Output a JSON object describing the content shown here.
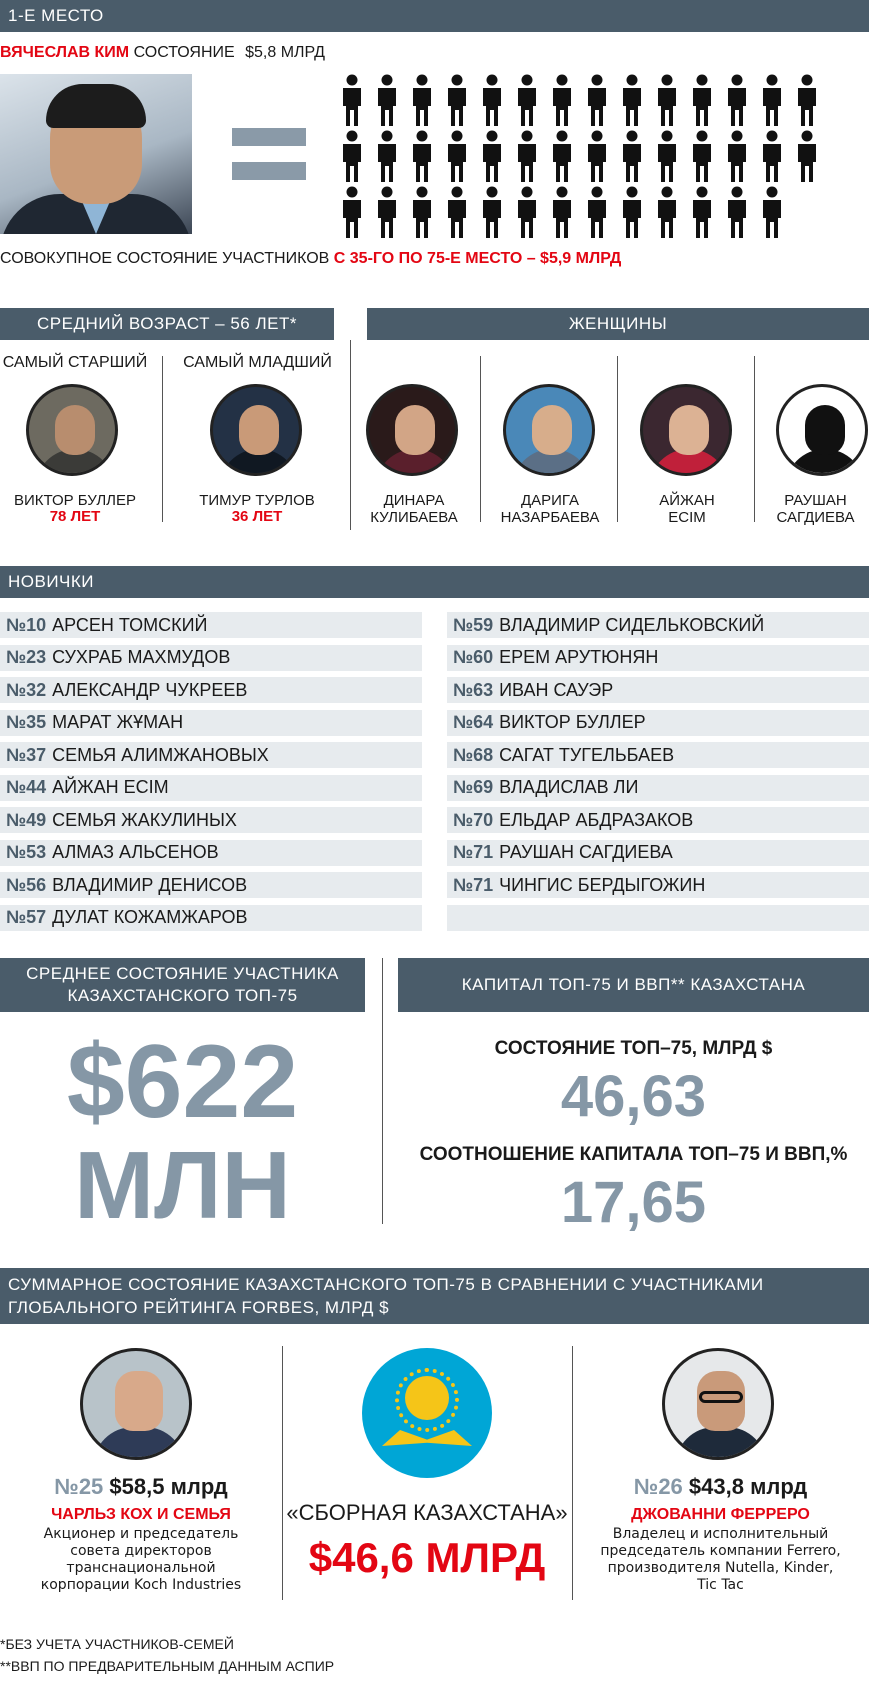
{
  "place": {
    "header": "1-Е МЕСТО",
    "name": "ВЯЧЕСЛАВ КИМ",
    "wealth_label": "СОСТОЯНИЕ",
    "wealth_value": "$5,8 МЛРД",
    "combined_text": "СОВОКУПНОЕ СОСТОЯНИЕ УЧАСТНИКОВ",
    "combined_highlight": "С 35-ГО ПО 75-Е МЕСТО – $5,9 МЛРД",
    "people_rows": [
      14,
      14,
      13
    ]
  },
  "age": {
    "header": "СРЕДНИЙ ВОЗРАСТ – 56 ЛЕТ*",
    "oldest_label": "САМЫЙ СТАРШИЙ",
    "youngest_label": "САМЫЙ МЛАДШИЙ",
    "oldest_name": "ВИКТОР БУЛЛЕР",
    "oldest_age": "78 ЛЕТ",
    "youngest_name": "ТИМУР ТУРЛОВ",
    "youngest_age": "36 ЛЕТ"
  },
  "women": {
    "header": "ЖЕНЩИНЫ",
    "list": [
      {
        "line1": "ДИНАРА",
        "line2": "КУЛИБАЕВА"
      },
      {
        "line1": "ДАРИГА",
        "line2": "НАЗАРБАЕВА"
      },
      {
        "line1": "АЙЖАН",
        "line2": "ЕСІМ"
      },
      {
        "line1": "РАУШАН",
        "line2": "САГДИЕВА"
      }
    ]
  },
  "newcomers": {
    "header": "НОВИЧКИ",
    "left": [
      {
        "num": "№10",
        "name": "АРСЕН ТОМСКИЙ"
      },
      {
        "num": "№23",
        "name": "СУХРАБ МАХМУДОВ"
      },
      {
        "num": "№32",
        "name": "АЛЕКСАНДР ЧУКРЕЕВ"
      },
      {
        "num": "№35",
        "name": "МАРАТ ЖҰМАН"
      },
      {
        "num": "№37",
        "name": "СЕМЬЯ АЛИМЖАНОВЫХ"
      },
      {
        "num": "№44",
        "name": "АЙЖАН ЕСІМ"
      },
      {
        "num": "№49",
        "name": "СЕМЬЯ ЖАКУЛИНЫХ"
      },
      {
        "num": "№53",
        "name": "АЛМАЗ АЛЬСЕНОВ"
      },
      {
        "num": "№56",
        "name": "ВЛАДИМИР ДЕНИСОВ"
      },
      {
        "num": "№57",
        "name": "ДУЛАТ КОЖАМЖАРОВ"
      }
    ],
    "right": [
      {
        "num": "№59",
        "name": "ВЛАДИМИР СИДЕЛЬКОВСКИЙ"
      },
      {
        "num": "№60",
        "name": "ЕРЕМ АРУТЮНЯН"
      },
      {
        "num": "№63",
        "name": "ИВАН САУЭР"
      },
      {
        "num": "№64",
        "name": "ВИКТОР БУЛЛЕР"
      },
      {
        "num": "№68",
        "name": "САГАТ ТУГЕЛЬБАЕВ"
      },
      {
        "num": "№69",
        "name": "ВЛАДИСЛАВ ЛИ"
      },
      {
        "num": "№70",
        "name": "ЕЛЬДАР АБДРАЗАКОВ"
      },
      {
        "num": "№71",
        "name": "РАУШАН САГДИЕВА"
      },
      {
        "num": "№71",
        "name": "ЧИНГИС БЕРДЫГОЖИН"
      },
      {
        "num": "",
        "name": ""
      }
    ]
  },
  "average": {
    "header_line1": "СРЕДНЕЕ СОСТОЯНИЕ УЧАСТНИКА",
    "header_line2": "КАЗАХСТАНСКОГО ТОП-75",
    "value": "$622",
    "unit": "МЛН"
  },
  "capital": {
    "header": "КАПИТАЛ ТОП-75 И ВВП** КАЗАХСТАНА",
    "label1": "СОСТОЯНИЕ ТОП–75, МЛРД $",
    "value1": "46,63",
    "label2": "СООТНОШЕНИЕ КАПИТАЛА ТОП–75 И ВВП,%",
    "value2": "17,65"
  },
  "global": {
    "header_line1": "СУММАРНОЕ СОСТОЯНИЕ КАЗАХСТАНСКОГО ТОП-75 В СРАВНЕНИИ С УЧАСТНИКАМИ",
    "header_line2": "ГЛОБАЛЬНОГО РЕЙТИНГА FORBES, МЛРД $",
    "left": {
      "rank": "№25",
      "value": "$58,5 млрд",
      "name": "ЧАРЛЬЗ КОХ И СЕМЬЯ",
      "desc": [
        "Акционер и председатель",
        "совета директоров",
        "транснациональной",
        "корпорации Koch Industries"
      ]
    },
    "center": {
      "label": "«СБОРНАЯ КАЗАХСТАНА»",
      "value": "$46,6 МЛРД"
    },
    "right": {
      "rank": "№26",
      "value": "$43,8 млрд",
      "name": "ДЖОВАННИ ФЕРРЕРО",
      "desc": [
        "Владелец и исполнительный",
        "председатель компании Ferrero,",
        "производителя Nutella, Kinder,",
        "Tic Tac"
      ]
    }
  },
  "footnotes": {
    "one": "*БЕЗ УЧЕТА УЧАСТНИКОВ-СЕМЕЙ",
    "two": "**ВВП ПО ПРЕДВАРИТЕЛЬНЫМ ДАННЫМ АСПИР"
  },
  "colors": {
    "bar": "#4a5c6a",
    "accent_red": "#e30613",
    "big_number": "#8597a6",
    "row_bg": "#e7ebee"
  }
}
